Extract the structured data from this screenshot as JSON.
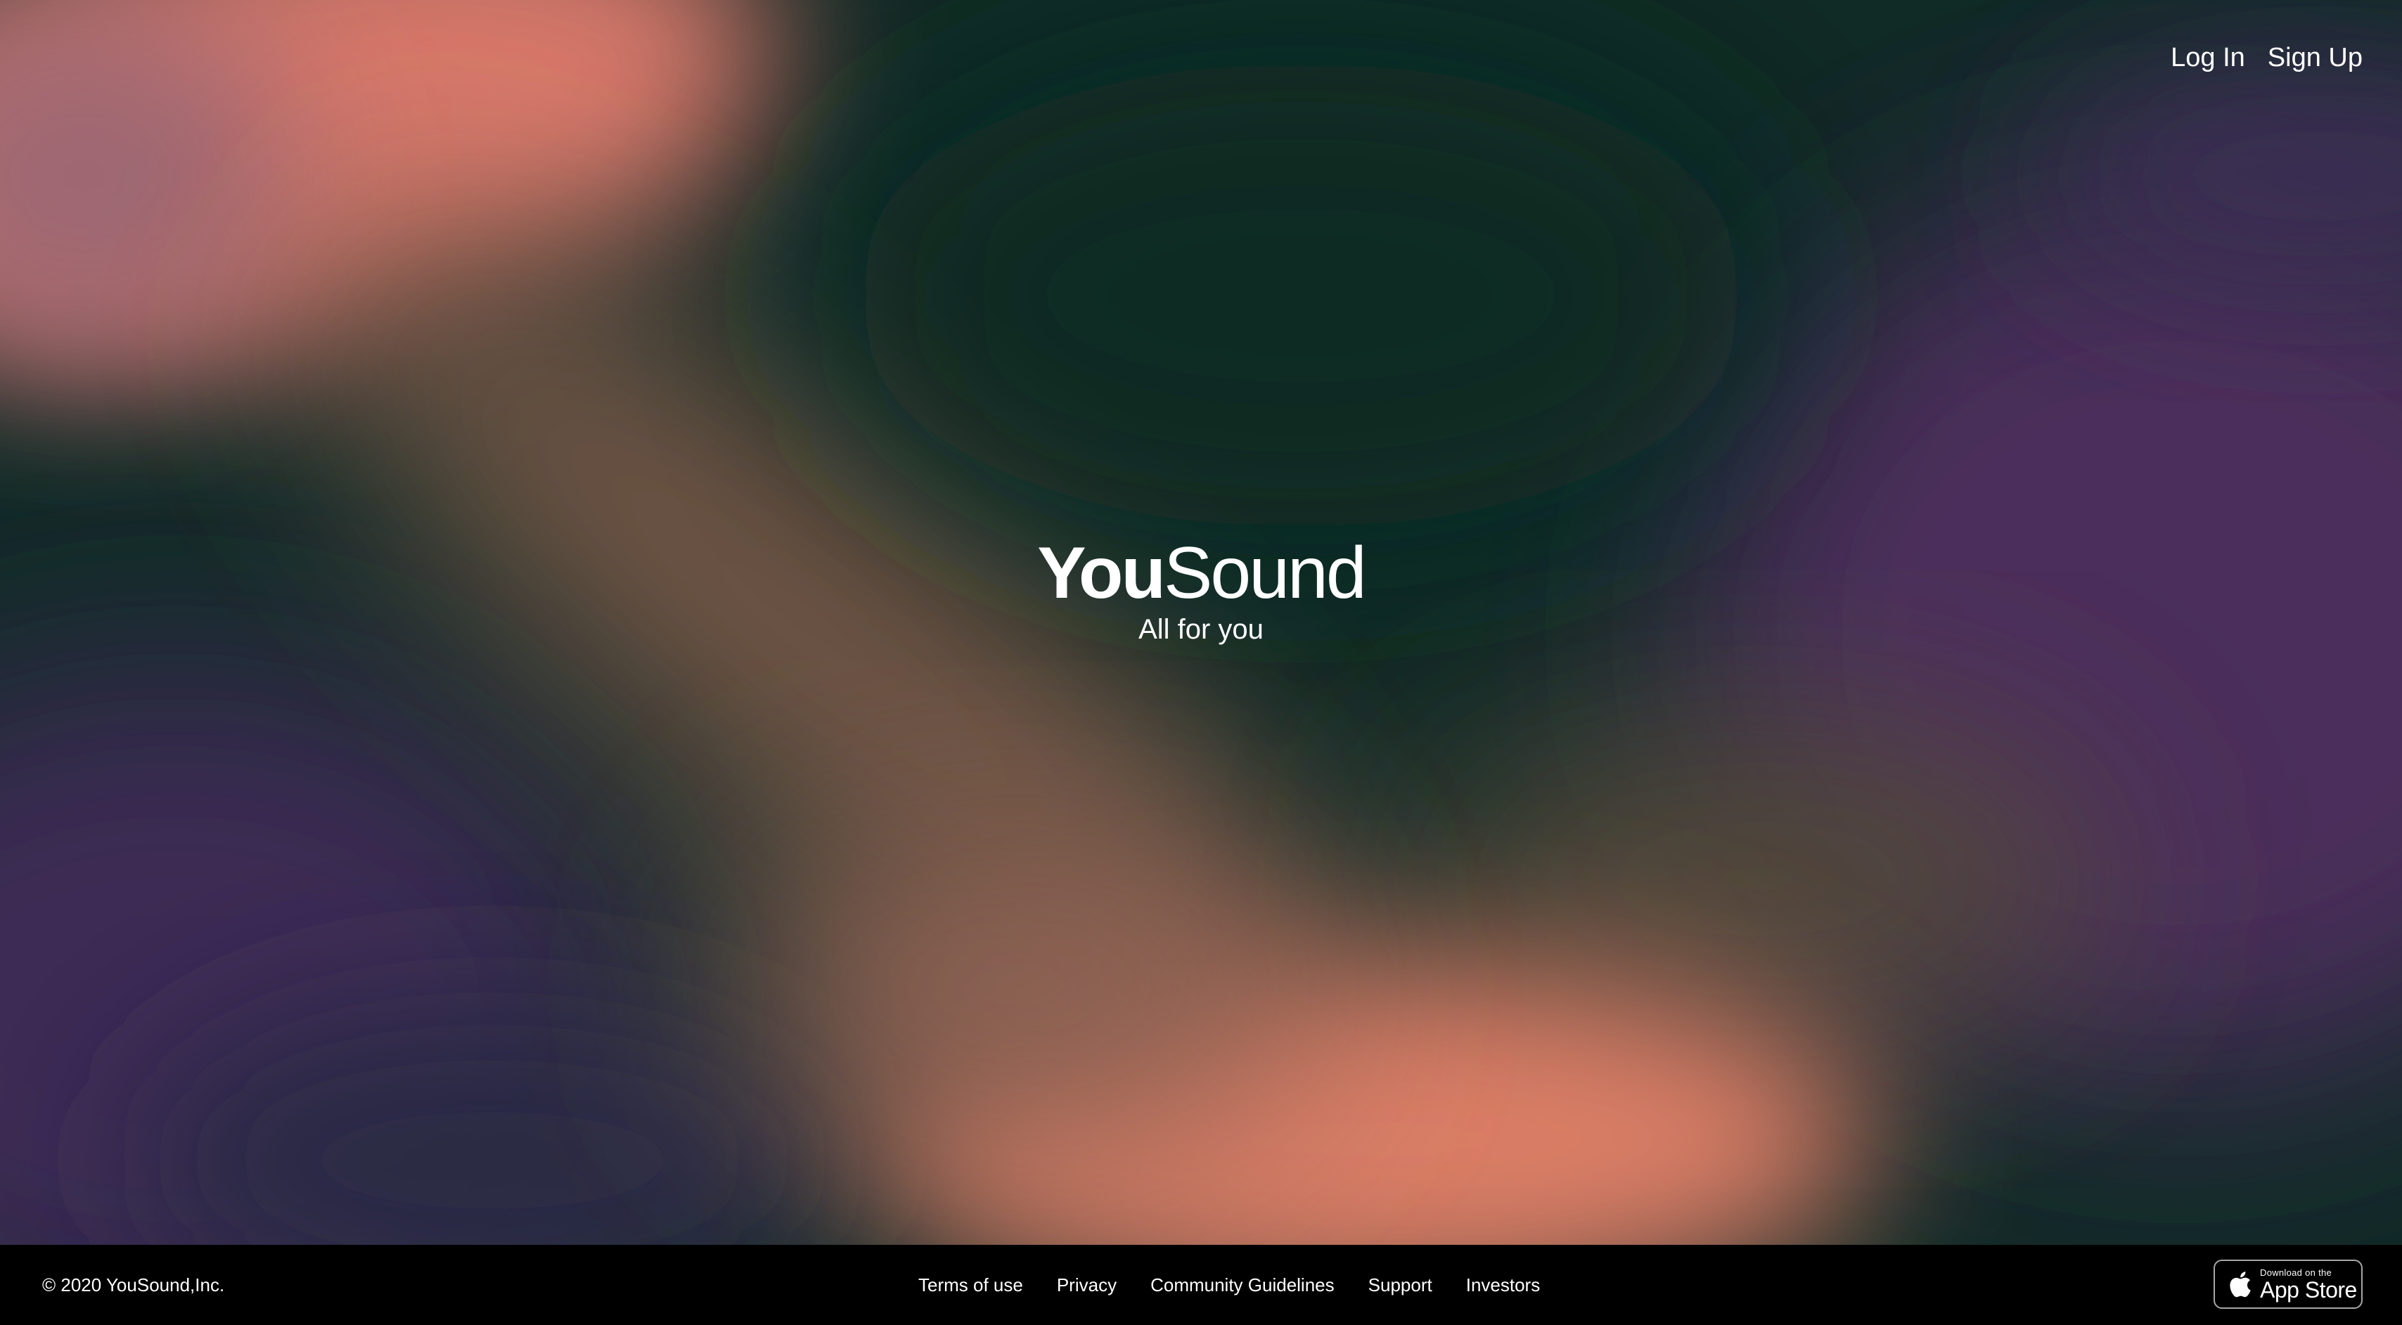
{
  "colors": {
    "coral": "#e07e68",
    "dark_green": "#0f2a26",
    "purple": "#4b2d5b",
    "navy": "#2a2a45",
    "footer_bg": "#000000",
    "text": "#ffffff"
  },
  "nav": {
    "login_label": "Log In",
    "signup_label": "Sign Up"
  },
  "brand": {
    "logo_bold": "You",
    "logo_light": "Sound",
    "tagline": "All for you"
  },
  "footer": {
    "copyright": "© 2020 YouSound,Inc.",
    "links": [
      {
        "label": "Terms of use"
      },
      {
        "label": "Privacy"
      },
      {
        "label": "Community Guidelines"
      },
      {
        "label": "Support"
      },
      {
        "label": "Investors"
      }
    ],
    "app_store": {
      "small_text": "Download on the",
      "big_text": "App Store",
      "icon": "apple-icon"
    }
  }
}
